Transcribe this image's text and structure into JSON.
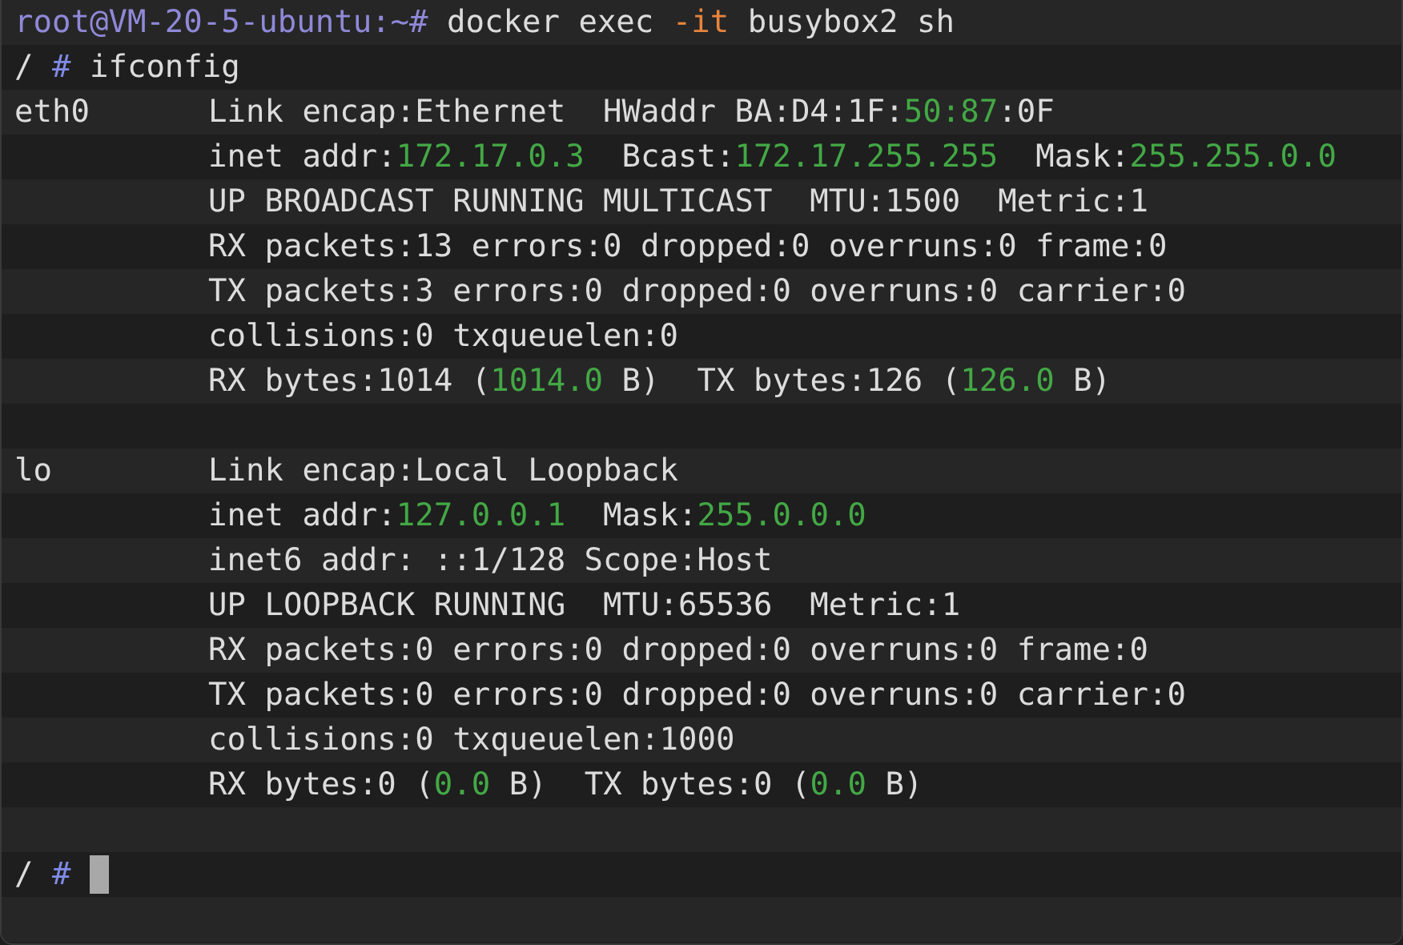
{
  "rows": [
    {
      "kind": "command",
      "segments": [
        {
          "kind": "user",
          "text": "root@VM-20-5-ubuntu:~#"
        },
        {
          "kind": "plain",
          "text": " docker exec "
        },
        {
          "kind": "option",
          "text": "-it"
        },
        {
          "kind": "plain",
          "text": " busybox2 sh"
        }
      ]
    },
    {
      "kind": "command",
      "segments": [
        {
          "kind": "plain",
          "text": "/ "
        },
        {
          "kind": "hash",
          "text": "#"
        },
        {
          "kind": "plain",
          "text": " ifconfig"
        }
      ]
    },
    {
      "kind": "interface",
      "name": "eth0",
      "lines": [
        [
          {
            "kind": "plain",
            "text": "Link encap:Ethernet  HWaddr BA:D4:1F:"
          },
          {
            "kind": "value",
            "text": "50:87"
          },
          {
            "kind": "plain",
            "text": ":0F"
          }
        ],
        [
          {
            "kind": "plain",
            "text": "inet addr:"
          },
          {
            "kind": "value",
            "text": "172.17.0.3"
          },
          {
            "kind": "plain",
            "text": "  Bcast:"
          },
          {
            "kind": "value",
            "text": "172.17.255.255"
          },
          {
            "kind": "plain",
            "text": "  Mask:"
          },
          {
            "kind": "value",
            "text": "255.255.0.0"
          }
        ],
        [
          {
            "kind": "plain",
            "text": "UP BROADCAST RUNNING MULTICAST  MTU:1500  Metric:1"
          }
        ],
        [
          {
            "kind": "plain",
            "text": "RX packets:13 errors:0 dropped:0 overruns:0 frame:0"
          }
        ],
        [
          {
            "kind": "plain",
            "text": "TX packets:3 errors:0 dropped:0 overruns:0 carrier:0"
          }
        ],
        [
          {
            "kind": "plain",
            "text": "collisions:0 txqueuelen:0"
          }
        ],
        [
          {
            "kind": "plain",
            "text": "RX bytes:1014 ("
          },
          {
            "kind": "value",
            "text": "1014.0"
          },
          {
            "kind": "plain",
            "text": " B)  TX bytes:126 ("
          },
          {
            "kind": "value",
            "text": "126.0"
          },
          {
            "kind": "plain",
            "text": " B)"
          }
        ]
      ]
    },
    {
      "kind": "blank"
    },
    {
      "kind": "interface",
      "name": "lo",
      "lines": [
        [
          {
            "kind": "plain",
            "text": "Link encap:Local Loopback"
          }
        ],
        [
          {
            "kind": "plain",
            "text": "inet addr:"
          },
          {
            "kind": "value",
            "text": "127.0.0.1"
          },
          {
            "kind": "plain",
            "text": "  Mask:"
          },
          {
            "kind": "value",
            "text": "255.0.0.0"
          }
        ],
        [
          {
            "kind": "plain",
            "text": "inet6 addr: ::1/128 Scope:Host"
          }
        ],
        [
          {
            "kind": "plain",
            "text": "UP LOOPBACK RUNNING  MTU:65536  Metric:1"
          }
        ],
        [
          {
            "kind": "plain",
            "text": "RX packets:0 errors:0 dropped:0 overruns:0 frame:0"
          }
        ],
        [
          {
            "kind": "plain",
            "text": "TX packets:0 errors:0 dropped:0 overruns:0 carrier:0"
          }
        ],
        [
          {
            "kind": "plain",
            "text": "collisions:0 txqueuelen:1000"
          }
        ],
        [
          {
            "kind": "plain",
            "text": "RX bytes:0 ("
          },
          {
            "kind": "value",
            "text": "0.0"
          },
          {
            "kind": "plain",
            "text": " B)  TX bytes:0 ("
          },
          {
            "kind": "value",
            "text": "0.0"
          },
          {
            "kind": "plain",
            "text": " B)"
          }
        ]
      ]
    },
    {
      "kind": "blank"
    },
    {
      "kind": "input",
      "cursor": true,
      "segments": [
        {
          "kind": "plain",
          "text": "/ "
        },
        {
          "kind": "hash",
          "text": "#"
        }
      ]
    }
  ]
}
